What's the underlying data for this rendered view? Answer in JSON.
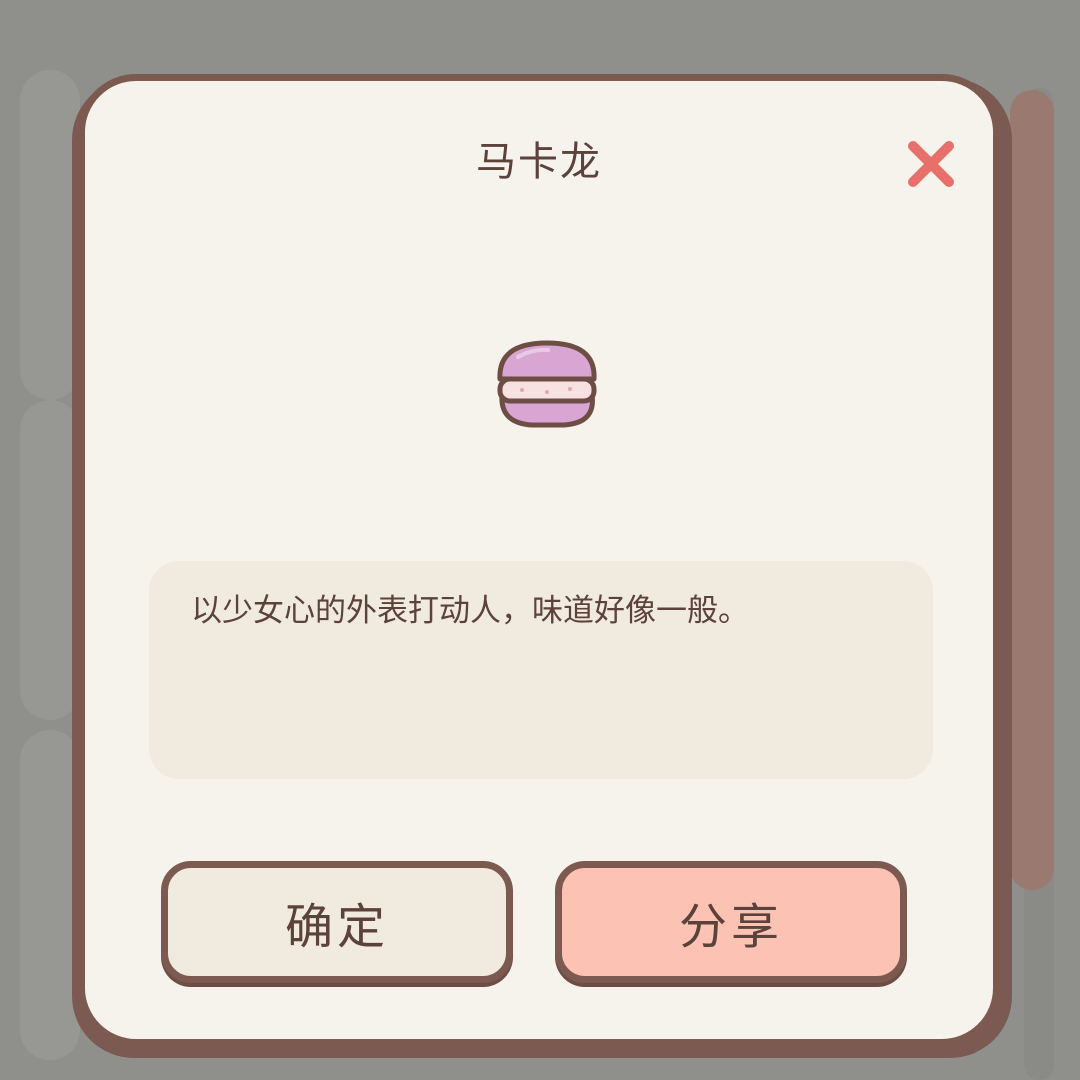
{
  "dialog": {
    "title": "马卡龙",
    "item_icon": "macaron-icon",
    "close_icon": "close-icon",
    "description": "以少女心的外表打动人，味道好像一般。",
    "confirm_label": "确定",
    "share_label": "分享"
  },
  "colors": {
    "overlay": "#8f8f8c",
    "panel": "#f6f3ec",
    "border": "#7d5a50",
    "close": "#e8706a",
    "desc_bg": "#f1eade",
    "confirm_bg": "#f1eade",
    "share_bg": "#fcc3b5",
    "macaron": "#d9a6d4",
    "scrollbar": "#9a7a70"
  }
}
